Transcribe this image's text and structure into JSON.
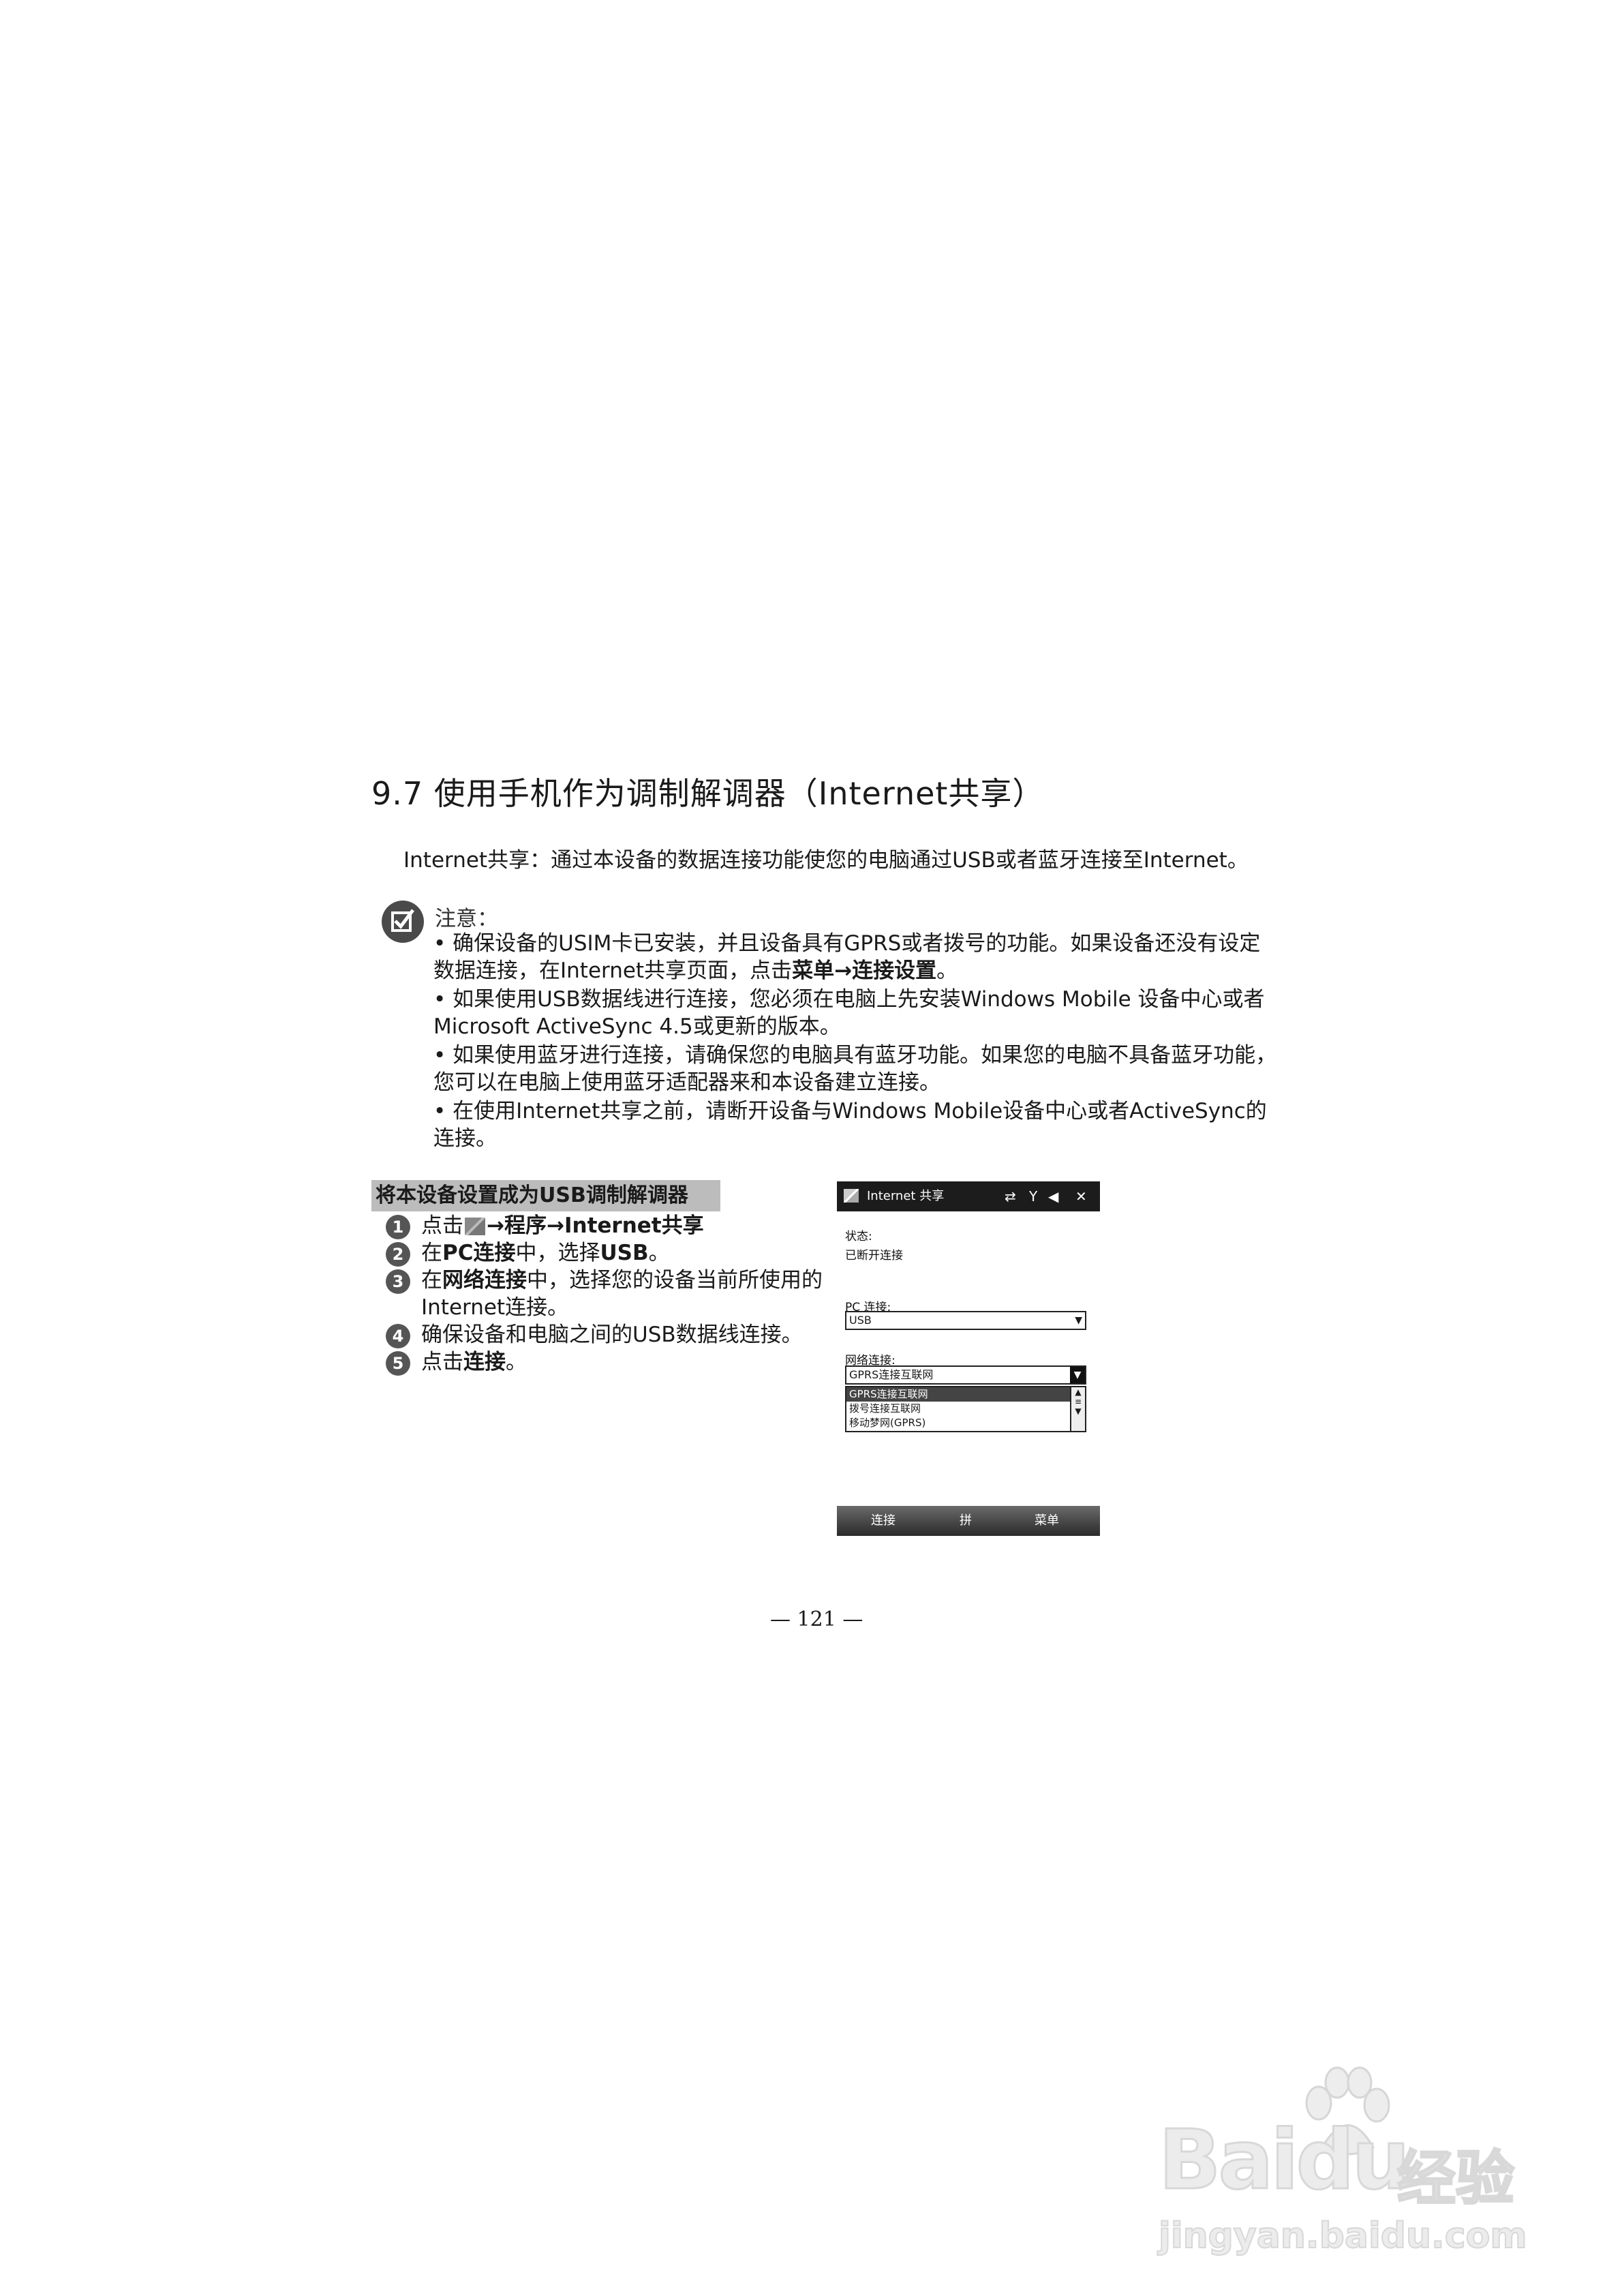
{
  "section": {
    "title": "9.7  使用手机作为调制解调器（Internet共享）",
    "intro": "Internet共享：通过本设备的数据连接功能使您的电脑通过USB或者蓝牙连接至Internet。"
  },
  "note": {
    "label": "注意：",
    "items": [
      {
        "prefix": "• 确保设备的USIM卡已安装，并且设备具有GPRS或者拨号的功能。如果设备还没有设定数据连接，在Internet共享页面，点击",
        "bold1": "菜单",
        "arrow": "→",
        "bold2": "连接设置",
        "suffix": "。"
      },
      {
        "text": "• 如果使用USB数据线进行连接，您必须在电脑上先安装Windows Mobile 设备中心或者Microsoft ActiveSync 4.5或更新的版本。"
      },
      {
        "text": "• 如果使用蓝牙进行连接，请确保您的电脑具有蓝牙功能。如果您的电脑不具备蓝牙功能，您可以在电脑上使用蓝牙适配器来和本设备建立连接。"
      },
      {
        "text": "• 在使用Internet共享之前，请断开设备与Windows Mobile设备中心或者ActiveSync的连接。"
      }
    ]
  },
  "steps": {
    "header": "将本设备设置成为USB调制解调器",
    "items": [
      {
        "num": "1",
        "pre": "点击",
        "mid1": "→",
        "b1": "程序",
        "mid2": "→",
        "b2": "Internet共享",
        "post": ""
      },
      {
        "num": "2",
        "pre": "在",
        "b1": "PC连接",
        "mid1": "中，选择",
        "b2": "USB",
        "post": "。"
      },
      {
        "num": "3",
        "pre": "在",
        "b1": "网络连接",
        "post": "中，选择您的设备当前所使用的Internet连接。"
      },
      {
        "num": "4",
        "text": "确保设备和电脑之间的USB数据线连接。"
      },
      {
        "num": "5",
        "pre": "点击",
        "b1": "连接",
        "post": "。"
      }
    ]
  },
  "phone": {
    "title": "Internet 共享",
    "status_icons": [
      "⇄",
      "Y",
      "◀",
      "✕"
    ],
    "status_label": "状态:",
    "status_value": "已断开连接",
    "pc_label": "PC 连接:",
    "pc_value": "USB",
    "net_label": "网络连接:",
    "net_value": "GPRS连接互联网",
    "net_options": [
      "GPRS连接互联网",
      "拨号连接互联网",
      "移动梦网(GPRS)"
    ],
    "soft_left": "连接",
    "soft_mid": "拼",
    "soft_right": "菜单"
  },
  "page_number": "— 121 —",
  "watermark": {
    "brand": "Baidu",
    "cn": "经验",
    "url": "jingyan.baidu.com"
  }
}
